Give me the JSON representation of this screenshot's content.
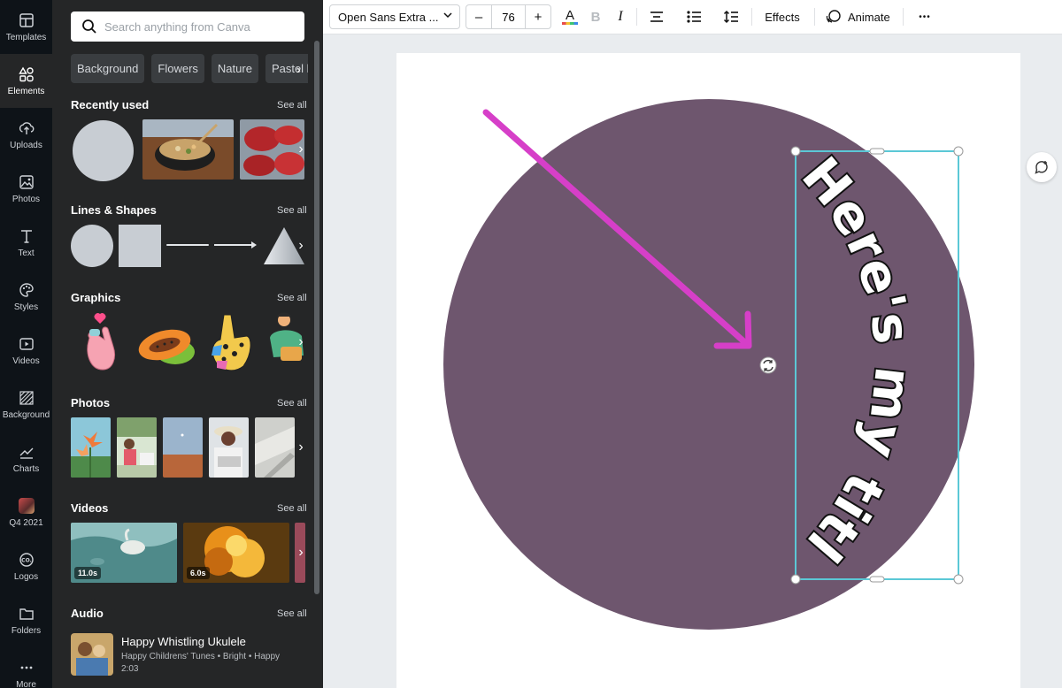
{
  "rail": {
    "items": [
      {
        "label": "Templates",
        "icon": "templates-icon"
      },
      {
        "label": "Elements",
        "icon": "elements-icon"
      },
      {
        "label": "Uploads",
        "icon": "uploads-icon"
      },
      {
        "label": "Photos",
        "icon": "photos-icon"
      },
      {
        "label": "Text",
        "icon": "text-icon"
      },
      {
        "label": "Styles",
        "icon": "styles-icon"
      },
      {
        "label": "Videos",
        "icon": "videos-icon"
      },
      {
        "label": "Background",
        "icon": "background-icon"
      },
      {
        "label": "Charts",
        "icon": "charts-icon"
      },
      {
        "label": "Q4 2021",
        "icon": "folder-thumbnail"
      },
      {
        "label": "Logos",
        "icon": "logos-icon"
      },
      {
        "label": "Folders",
        "icon": "folders-icon"
      },
      {
        "label": "More",
        "icon": "more-icon"
      }
    ],
    "active": "Elements"
  },
  "panel": {
    "search_placeholder": "Search anything from Canva",
    "chips": [
      "Background",
      "Flowers",
      "Nature",
      "Pastel b"
    ],
    "see_all": "See all",
    "sections": {
      "recent": "Recently used",
      "lines": "Lines & Shapes",
      "graphics": "Graphics",
      "photos": "Photos",
      "videos": "Videos",
      "audio": "Audio"
    },
    "videos": [
      {
        "duration": "11.0s"
      },
      {
        "duration": "6.0s"
      }
    ],
    "audio": {
      "title": "Happy Whistling Ukulele",
      "meta": "Happy Childrens' Tunes • Bright • Happy",
      "duration": "2:03"
    }
  },
  "toolbar": {
    "font": "Open Sans Extra ...",
    "size": "76",
    "minus": "–",
    "plus": "+",
    "effects": "Effects",
    "animate": "Animate",
    "more": "•••"
  },
  "canvas": {
    "curved_text": "Here's my title",
    "circle_color": "#6e566e",
    "arrow_color": "#d63fc8",
    "selection_color": "#5bc8d6"
  },
  "colors": {
    "rail_bg": "#0e1318",
    "panel_bg": "#252627",
    "accent": "#7d2ae8"
  }
}
